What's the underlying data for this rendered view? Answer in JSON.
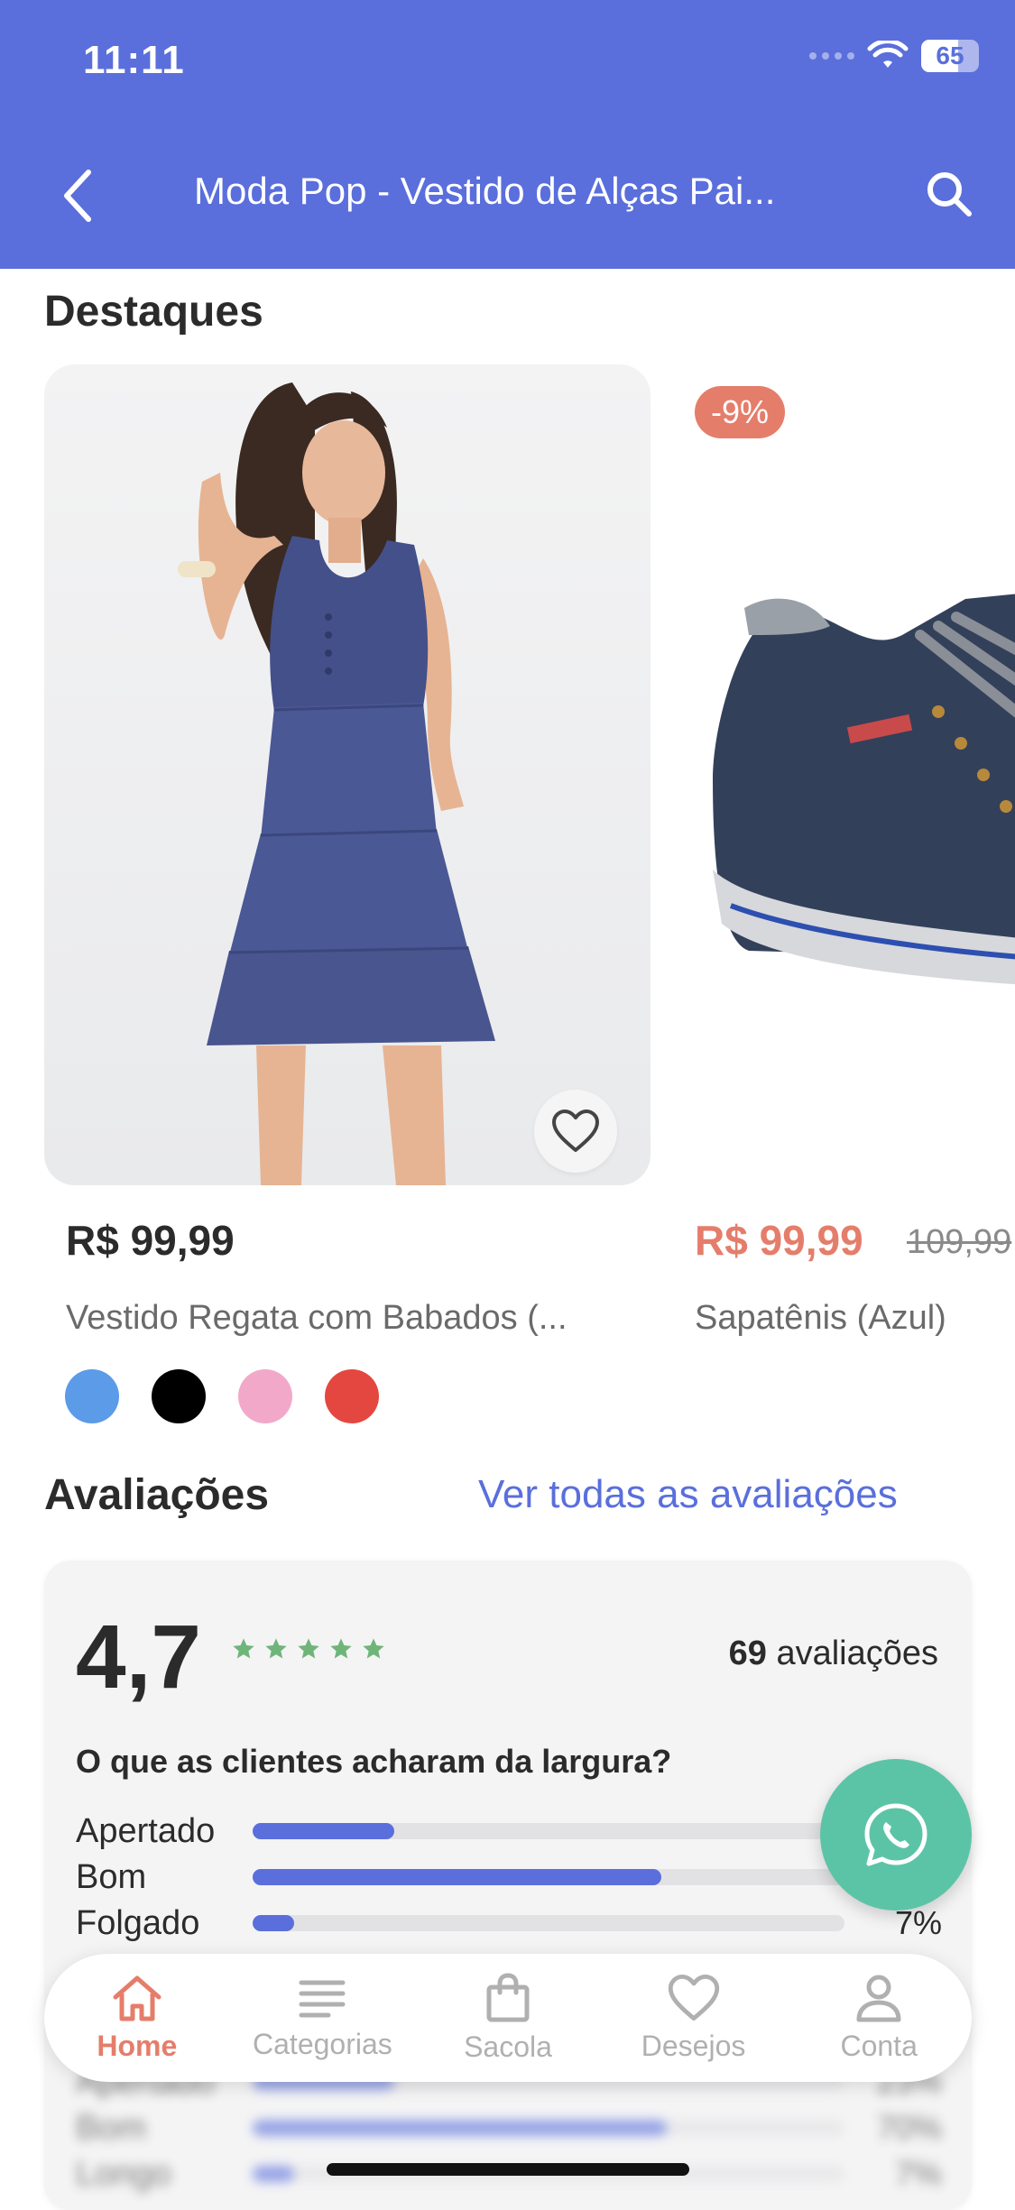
{
  "status_bar": {
    "time": "11:11",
    "battery": "65"
  },
  "header": {
    "title": "Moda Pop - Vestido de Alças Pai..."
  },
  "highlights": {
    "title": "Destaques",
    "products": [
      {
        "price": "R$ 99,99",
        "name": "Vestido Regata com Babados (...",
        "colors": [
          "#5B9BE8",
          "#000000",
          "#F2A9C9",
          "#E4473F"
        ]
      },
      {
        "discount": "-9%",
        "price": "R$ 99,99",
        "old_price": "109,99",
        "name": "Sapatênis (Azul)"
      }
    ]
  },
  "reviews": {
    "title": "Avaliações",
    "see_all": "Ver todas as avaliações",
    "rating": "4,7",
    "stars": 5,
    "count": "69",
    "count_label": "avaliações",
    "question": "O que as clientes acharam da largura?",
    "fit": [
      {
        "label": "Apertado",
        "percent": 24,
        "pct_text": ""
      },
      {
        "label": "Bom",
        "percent": 69,
        "pct_text": ""
      },
      {
        "label": "Folgado",
        "percent": 7,
        "pct_text": "7%"
      }
    ],
    "blurred": [
      {
        "label": "Apertado",
        "percent": 24,
        "pct_text": "23%"
      },
      {
        "label": "Bom",
        "percent": 70,
        "pct_text": "70%"
      },
      {
        "label": "Longo",
        "percent": 7,
        "pct_text": "7%"
      }
    ]
  },
  "tabbar": {
    "items": [
      {
        "label": "Home",
        "icon": "home-icon",
        "active": true
      },
      {
        "label": "Categorias",
        "icon": "list-icon",
        "active": false
      },
      {
        "label": "Sacola",
        "icon": "bag-icon",
        "active": false
      },
      {
        "label": "Desejos",
        "icon": "heart-icon",
        "active": false
      },
      {
        "label": "Conta",
        "icon": "user-icon",
        "active": false
      }
    ]
  },
  "colors": {
    "primary": "#5A6FDC",
    "accent": "#E57D6B",
    "whatsapp": "#5CC4A6",
    "star": "#6FB57A"
  }
}
